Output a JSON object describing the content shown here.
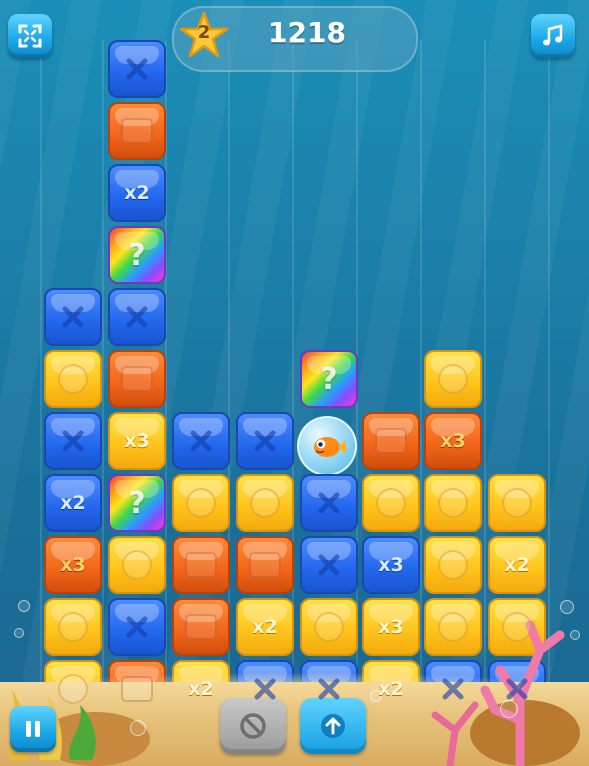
{
  "hud": {
    "star_level": "2",
    "score": "1218"
  },
  "buttons": {
    "fullscreen_icon": "fullscreen-icon",
    "music_icon": "music-note-icon",
    "pause_icon": "pause-icon",
    "cancel_icon": "prohibited-icon",
    "launch_icon": "arrow-up-icon"
  },
  "colors": {
    "blue": "#2166ec",
    "orange": "#f06418",
    "yellow": "#ffc21a"
  },
  "board": {
    "columns": 8,
    "rows_from_top": [
      [
        "",
        "blue",
        "",
        "",
        "",
        "",
        "",
        ""
      ],
      [
        "",
        "orange",
        "",
        "",
        "",
        "",
        "",
        ""
      ],
      [
        "",
        "blue:x2",
        "",
        "",
        "",
        "",
        "",
        ""
      ],
      [
        "",
        "rainbow",
        "",
        "",
        "",
        "",
        "",
        ""
      ],
      [
        "blue",
        "blue",
        "",
        "",
        "",
        "",
        "",
        ""
      ],
      [
        "yellow",
        "orange",
        "",
        "",
        "rainbow",
        "",
        "yellow",
        ""
      ],
      [
        "blue",
        "yellow:x3",
        "blue",
        "blue",
        "fish",
        "orange",
        "orange:x3",
        ""
      ],
      [
        "blue:x2",
        "rainbow",
        "yellow",
        "yellow",
        "blue",
        "yellow",
        "yellow",
        "yellow"
      ],
      [
        "orange:x3",
        "yellow",
        "orange",
        "orange",
        "blue",
        "blue:x3",
        "yellow",
        "yellow:x2"
      ],
      [
        "yellow",
        "blue",
        "orange",
        "yellow:x2",
        "yellow",
        "yellow:x3",
        "yellow",
        "yellow"
      ],
      [
        "yellow",
        "orange",
        "yellow:x2",
        "blue",
        "blue",
        "yellow:x2",
        "blue",
        "blue"
      ]
    ]
  },
  "labels": {
    "x2": "x2",
    "x3": "x3",
    "mystery": "?"
  }
}
